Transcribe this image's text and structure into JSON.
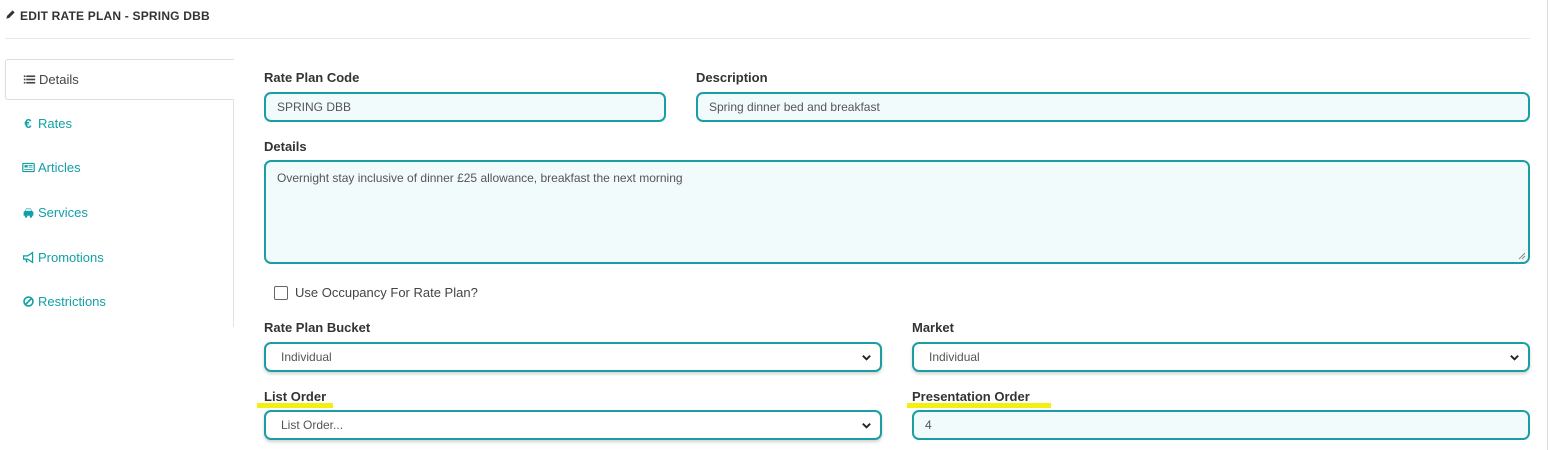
{
  "header": {
    "title": "EDIT RATE PLAN - SPRING DBB"
  },
  "sidebar": {
    "items": [
      {
        "label": "Details",
        "icon": "list-icon",
        "active": true
      },
      {
        "label": "Rates",
        "icon": "euro-icon",
        "active": false
      },
      {
        "label": "Articles",
        "icon": "newspaper-icon",
        "active": false
      },
      {
        "label": "Services",
        "icon": "taxi-icon",
        "active": false
      },
      {
        "label": "Promotions",
        "icon": "bullhorn-icon",
        "active": false
      },
      {
        "label": "Restrictions",
        "icon": "ban-icon",
        "active": false
      }
    ]
  },
  "form": {
    "rate_plan_code": {
      "label": "Rate Plan Code",
      "value": "SPRING DBB"
    },
    "description": {
      "label": "Description",
      "value": "Spring dinner bed and breakfast"
    },
    "details": {
      "label": "Details",
      "value": "Overnight stay inclusive of dinner £25 allowance, breakfast the next morning"
    },
    "use_occupancy": {
      "label": "Use Occupancy For Rate Plan?",
      "checked": false
    },
    "rate_plan_bucket": {
      "label": "Rate Plan Bucket",
      "value": "Individual"
    },
    "market": {
      "label": "Market",
      "value": "Individual"
    },
    "list_order": {
      "label": "List Order",
      "value": "List Order..."
    },
    "presentation_order": {
      "label": "Presentation Order",
      "value": "4"
    }
  },
  "colors": {
    "accent": "#1a9ea4",
    "link": "#11a0a6",
    "highlight": "#f2ef13"
  }
}
